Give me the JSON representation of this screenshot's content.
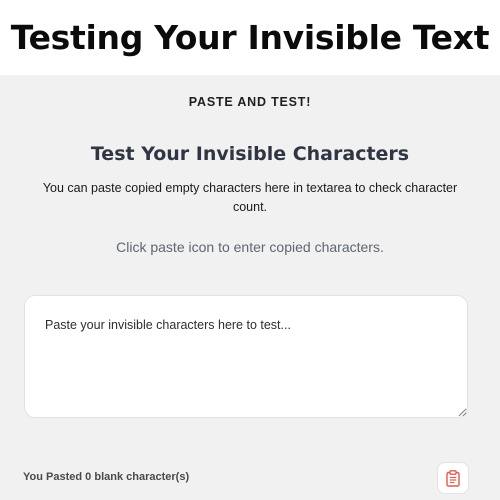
{
  "banner": {
    "title": "Testing Your Invisible Text"
  },
  "tester": {
    "section_label": "PASTE AND TEST!",
    "heading": "Test Your Invisible Characters",
    "description": "You can paste copied empty characters here in textarea to check character count.",
    "hint": "Click paste icon to enter copied characters.",
    "textarea": {
      "placeholder": "Paste your invisible characters here to test...",
      "value": ""
    },
    "count": {
      "prefix": "You Pasted",
      "value": "0",
      "suffix": "blank character(s)"
    },
    "paste_button": {
      "icon": "clipboard-icon",
      "accent_color": "#e05a4f"
    }
  },
  "colors": {
    "panel_background": "#f1f1f1",
    "heading": "#2f3542",
    "hint": "#5e6670"
  }
}
